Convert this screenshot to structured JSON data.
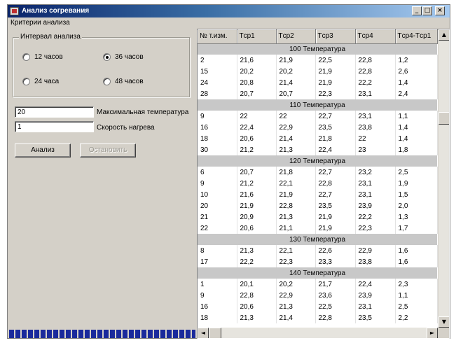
{
  "window": {
    "title": "Анализ согревания",
    "min_symbol": "_",
    "max_symbol": "□",
    "close_symbol": "×"
  },
  "menu": {
    "criteria_label": "Критерии анализа"
  },
  "interval": {
    "title": "Интервал анализа",
    "options": [
      {
        "label": "12 часов",
        "checked": false
      },
      {
        "label": "36 часов",
        "checked": true
      },
      {
        "label": "24 часа",
        "checked": false
      },
      {
        "label": "48 часов",
        "checked": false
      }
    ]
  },
  "fields": {
    "max_temp": {
      "value": "20",
      "label": "Максимальная температура"
    },
    "heat_rate": {
      "value": "1",
      "label": "Скорость нагрева"
    }
  },
  "buttons": {
    "analyze": "Анализ",
    "stop": "Остановить"
  },
  "table": {
    "columns": [
      "№ т.изм.",
      "Tср1",
      "Tср2",
      "Tср3",
      "Tср4",
      "Tср4-Tср1"
    ],
    "groups": [
      {
        "title": "100 Температура",
        "rows": [
          [
            "2",
            "21,6",
            "21,9",
            "22,5",
            "22,8",
            "1,2"
          ],
          [
            "15",
            "20,2",
            "20,2",
            "21,9",
            "22,8",
            "2,6"
          ],
          [
            "24",
            "20,8",
            "21,4",
            "21,9",
            "22,2",
            "1,4"
          ],
          [
            "28",
            "20,7",
            "20,7",
            "22,3",
            "23,1",
            "2,4"
          ]
        ]
      },
      {
        "title": "110 Температура",
        "rows": [
          [
            "9",
            "22",
            "22",
            "22,7",
            "23,1",
            "1,1"
          ],
          [
            "16",
            "22,4",
            "22,9",
            "23,5",
            "23,8",
            "1,4"
          ],
          [
            "18",
            "20,6",
            "21,4",
            "21,8",
            "22",
            "1,4"
          ],
          [
            "30",
            "21,2",
            "21,3",
            "22,4",
            "23",
            "1,8"
          ]
        ]
      },
      {
        "title": "120 Температура",
        "rows": [
          [
            "6",
            "20,7",
            "21,8",
            "22,7",
            "23,2",
            "2,5"
          ],
          [
            "9",
            "21,2",
            "22,1",
            "22,8",
            "23,1",
            "1,9"
          ],
          [
            "10",
            "21,6",
            "21,9",
            "22,7",
            "23,1",
            "1,5"
          ],
          [
            "20",
            "21,9",
            "22,8",
            "23,5",
            "23,9",
            "2,0"
          ],
          [
            "21",
            "20,9",
            "21,3",
            "21,9",
            "22,2",
            "1,3"
          ],
          [
            "22",
            "20,6",
            "21,1",
            "21,9",
            "22,3",
            "1,7"
          ]
        ]
      },
      {
        "title": "130 Температура",
        "rows": [
          [
            "8",
            "21,3",
            "22,1",
            "22,6",
            "22,9",
            "1,6"
          ],
          [
            "17",
            "22,2",
            "22,3",
            "23,3",
            "23,8",
            "1,6"
          ]
        ]
      },
      {
        "title": "140 Температура",
        "rows": [
          [
            "1",
            "20,1",
            "20,2",
            "21,7",
            "22,4",
            "2,3"
          ],
          [
            "9",
            "22,8",
            "22,9",
            "23,6",
            "23,9",
            "1,1"
          ],
          [
            "16",
            "20,6",
            "21,3",
            "22,5",
            "23,1",
            "2,5"
          ],
          [
            "18",
            "21,3",
            "21,4",
            "22,8",
            "23,5",
            "2,2"
          ]
        ]
      }
    ]
  },
  "scroll_symbols": {
    "up": "▲",
    "down": "▼",
    "left": "◄",
    "right": "►"
  }
}
